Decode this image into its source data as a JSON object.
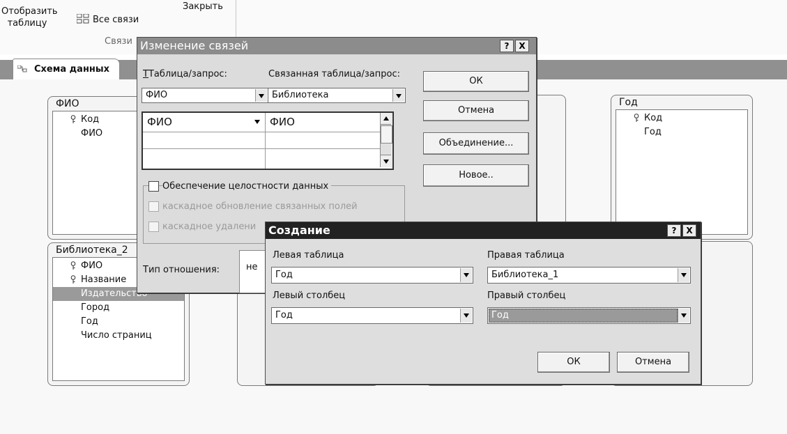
{
  "ribbon": {
    "show_table_line1": "Отобразить",
    "show_table_line2": "таблицу",
    "all_links": "Все связи",
    "close": "Закрыть",
    "group_label": "Связи"
  },
  "tab": {
    "label": "Схема данных"
  },
  "tables": [
    {
      "title": "ФИО",
      "fields": [
        {
          "name": "Код",
          "key": true
        },
        {
          "name": "ФИО",
          "key": false
        }
      ]
    },
    {
      "title": "Год",
      "fields": [
        {
          "name": "Код",
          "key": true
        },
        {
          "name": "Год",
          "key": false
        }
      ]
    },
    {
      "title": "Библиотека_2",
      "fields": [
        {
          "name": "ФИО",
          "key": true
        },
        {
          "name": "Название",
          "key": true
        },
        {
          "name": "Издательство",
          "key": false,
          "selected": true
        },
        {
          "name": "Город",
          "key": false
        },
        {
          "name": "Год",
          "key": false
        },
        {
          "name": "Число страниц",
          "key": false
        }
      ]
    }
  ],
  "edit_dialog": {
    "title": "Изменение связей",
    "help_btn": "?",
    "close_btn": "X",
    "table_label": "Таблица/запрос:",
    "related_label": "Связанная таблица/запрос:",
    "table_value": "ФИО",
    "related_value": "Библиотека",
    "grid_left": "ФИО",
    "grid_right": "ФИО",
    "ok": "ОК",
    "cancel": "Отмена",
    "join": "Объединение...",
    "new": "Новое..",
    "integrity": "Обеспечение целостности данных",
    "cascade_update": "каскадное обновление связанных полей",
    "cascade_delete": "каскадное удалени",
    "relation_type_label": "Тип отношения:",
    "relation_type_value": "не"
  },
  "create_dialog": {
    "title": "Создание",
    "help_btn": "?",
    "close_btn": "X",
    "left_table_label": "Левая таблица",
    "left_table_value": "Год",
    "right_table_label": "Правая таблица",
    "right_table_value": "Библиотека_1",
    "left_col_label": "Левый столбец",
    "left_col_value": "Год",
    "right_col_label": "Правый столбец",
    "right_col_value": "Год",
    "ok": "ОК",
    "cancel": "Отмена"
  },
  "colors": {
    "title_active": "#202020",
    "title_inactive": "#8c8c8c",
    "tab_strip": "#909090"
  }
}
